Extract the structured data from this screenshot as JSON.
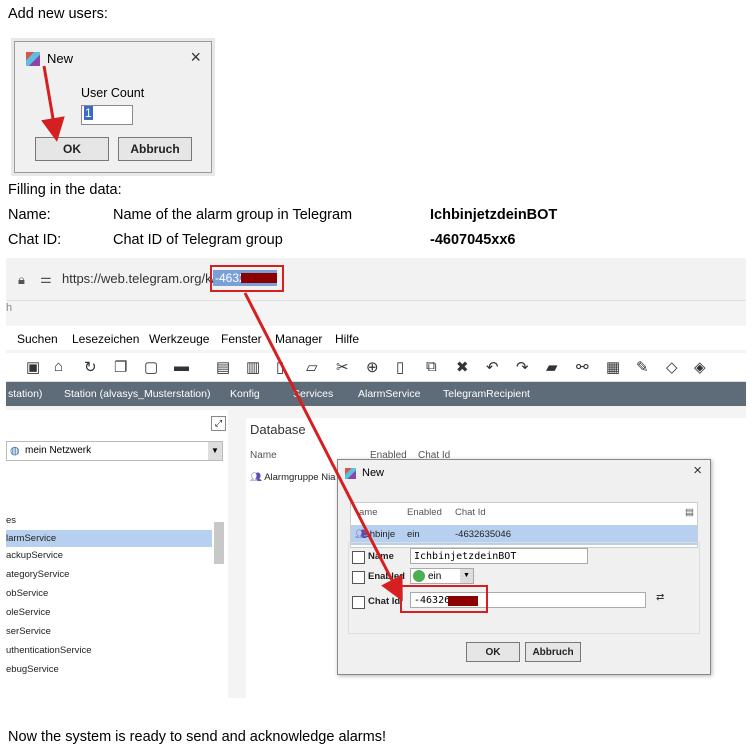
{
  "doc": {
    "intro": "Add new users:",
    "filling": "Filling in the data:",
    "rows": [
      {
        "label": "Name:",
        "desc": "Name of the alarm group in Telegram",
        "value": "IchbinjetzdeinBOT"
      },
      {
        "label": "Chat ID:",
        "desc": "Chat ID of Telegram group",
        "value": "-4607045xx6"
      }
    ],
    "outro": "Now the system is ready to send and acknowledge alarms!"
  },
  "dialog1": {
    "title": "New",
    "label": "User Count",
    "value": "1",
    "ok": "OK",
    "cancel": "Abbruch"
  },
  "browser": {
    "url": "https://web.telegram.org/k/#",
    "url_selected": "-4632",
    "partial": "h"
  },
  "menu": [
    "Suchen",
    "Lesezeichen",
    "Werkzeuge",
    "Fenster",
    "Manager",
    "Hilfe"
  ],
  "breadcrumb": [
    "station)",
    "Station (alvasys_Musterstation)",
    "Konfig",
    "Services",
    "AlarmService",
    "TelegramRecipient"
  ],
  "nav": {
    "network": "mein Netzwerk",
    "items": [
      "es",
      "larmService",
      "ackupService",
      "ategoryService",
      "obService",
      "oleService",
      "serService",
      "uthenticationService",
      "ebugService"
    ]
  },
  "database": {
    "title": "Database",
    "cols": [
      "Name",
      "Enabled",
      "Chat Id"
    ],
    "row_name": "Alarmgruppe Nia"
  },
  "dialog2": {
    "title": "New",
    "cols": [
      "ame",
      "Enabled",
      "Chat Id"
    ],
    "row": {
      "name": "chbinje",
      "enabled": "ein",
      "chat_id": "-4632635046"
    },
    "name_label": "Name",
    "name_value": "IchbinjetzdeinBOT",
    "enabled_label": "Enabled",
    "enabled_value": "ein",
    "chatid_label": "Chat Id",
    "chatid_value": "-46326",
    "ok": "OK",
    "cancel": "Abbruch"
  },
  "colors": {
    "highlight": "#d42020",
    "selection": "#b8d0ef",
    "crumb_bg": "#5e6b78"
  }
}
